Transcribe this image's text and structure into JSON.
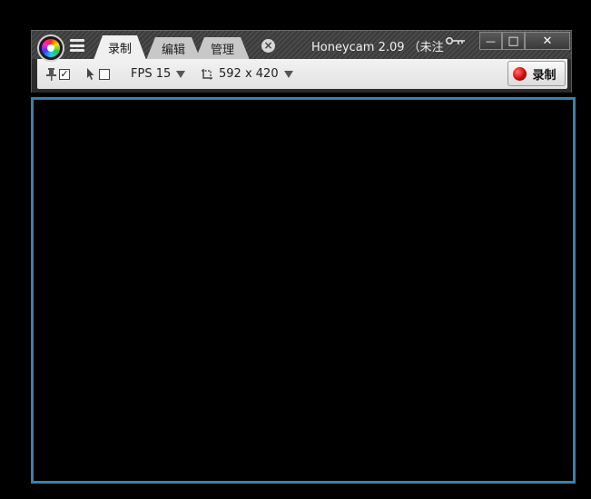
{
  "window": {
    "title": "Honeycam 2.09 （未注",
    "minimize_symbol": "—",
    "maximize_symbol": "□",
    "close_symbol": "✕"
  },
  "tabs": [
    {
      "label": "录制",
      "active": true
    },
    {
      "label": "编辑",
      "active": false
    },
    {
      "label": "管理",
      "active": false
    }
  ],
  "tab_close_symbol": "×",
  "toolbar": {
    "pin_checked_mark": "✓",
    "cursor_checked_mark": "",
    "fps_label": "FPS 15",
    "size_label": "592 x 420",
    "record_label": "录制"
  },
  "icons": {
    "logo": "honeycam-logo-icon",
    "menu": "hamburger-menu-icon",
    "key": "key-icon",
    "pin": "pin-icon",
    "cursor": "mouse-cursor-icon",
    "resize": "resize-icon",
    "record": "record-dot-icon"
  },
  "colors": {
    "capture_border": "#3d7fa8",
    "record_dot": "#cc0000",
    "background": "#000000"
  }
}
